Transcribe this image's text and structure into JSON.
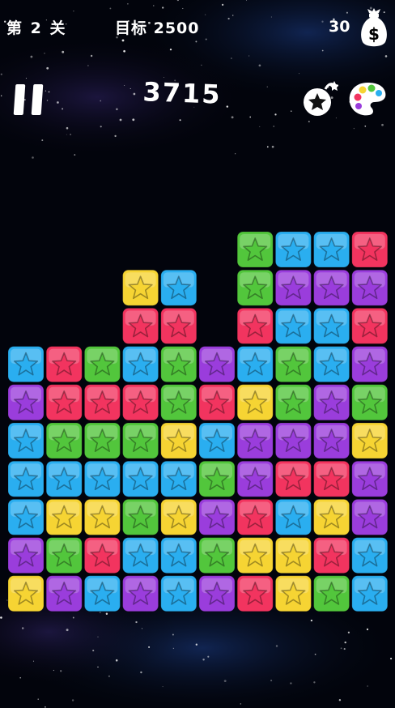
{
  "header": {
    "level": "第 2 关",
    "target": "目标 2500",
    "coins": "30"
  },
  "score": "3715",
  "icons": {
    "money_bag": "money-bag-icon",
    "pause": "pause-icon",
    "bomb": "bomb-star-icon",
    "palette": "palette-icon"
  },
  "colors": {
    "red": "#f2345f",
    "blue": "#2aaef0",
    "green": "#52c63c",
    "purple": "#9a3ddc",
    "yellow": "#f6d433"
  },
  "board": {
    "columns": 10,
    "grid": [
      [
        "",
        "",
        "",
        "",
        "",
        "",
        "G",
        "B",
        "B",
        "R"
      ],
      [
        "",
        "",
        "",
        "Y",
        "B",
        "",
        "G",
        "P",
        "P",
        "P"
      ],
      [
        "",
        "",
        "",
        "R",
        "R",
        "",
        "R",
        "B",
        "B",
        "R"
      ],
      [
        "B",
        "R",
        "G",
        "B",
        "G",
        "P",
        "B",
        "G",
        "B",
        "P"
      ],
      [
        "P",
        "R",
        "R",
        "R",
        "G",
        "R",
        "Y",
        "G",
        "P",
        "G"
      ],
      [
        "B",
        "G",
        "G",
        "G",
        "Y",
        "B",
        "P",
        "P",
        "P",
        "Y"
      ],
      [
        "B",
        "B",
        "B",
        "B",
        "B",
        "G",
        "P",
        "R",
        "R",
        "P"
      ],
      [
        "B",
        "Y",
        "Y",
        "G",
        "Y",
        "P",
        "R",
        "B",
        "Y",
        "P"
      ],
      [
        "P",
        "G",
        "R",
        "B",
        "B",
        "G",
        "Y",
        "Y",
        "R",
        "B"
      ],
      [
        "Y",
        "P",
        "B",
        "P",
        "B",
        "P",
        "R",
        "Y",
        "G",
        "B"
      ]
    ]
  }
}
